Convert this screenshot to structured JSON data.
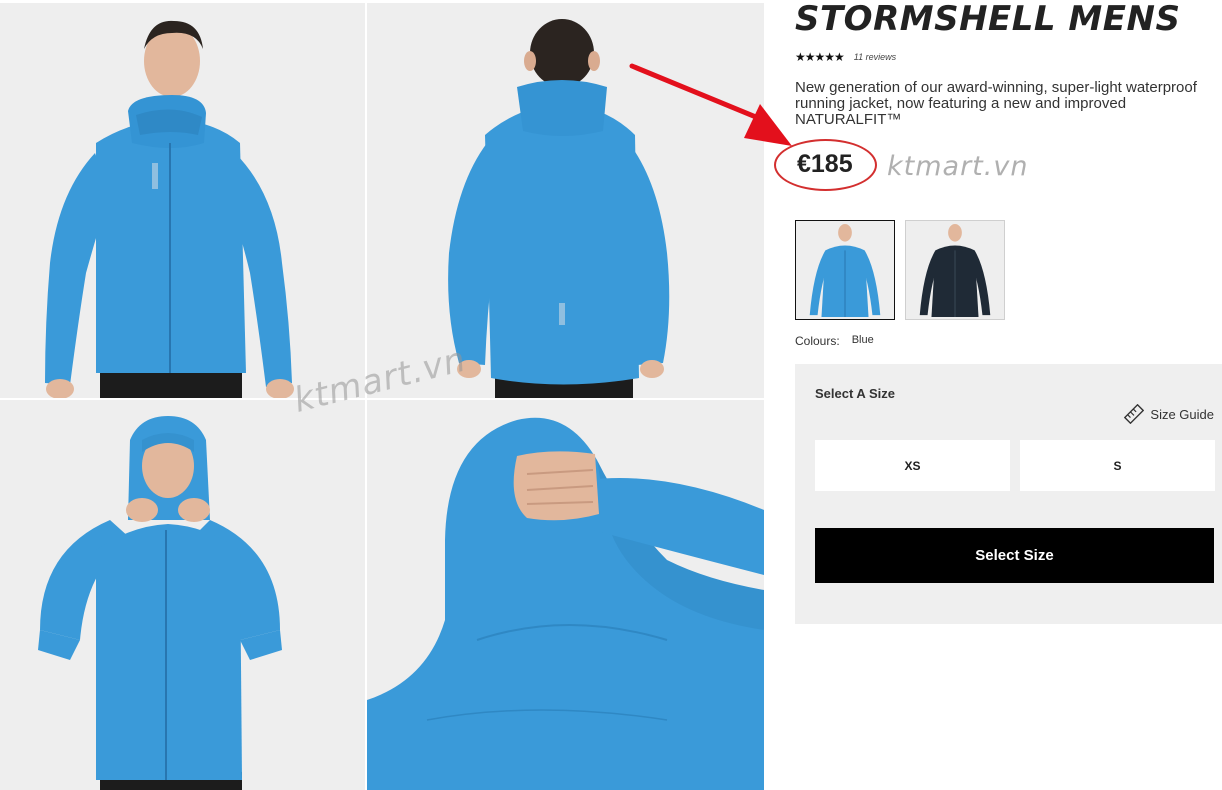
{
  "product": {
    "title": "STORMSHELL MENS",
    "stars": "★★★★★",
    "reviews": "11 reviews",
    "description": "New generation of our award-winning, super-light waterproof running jacket, now featuring a new and improved NATURALFIT™",
    "price": "€185"
  },
  "watermark": "ktmart.vn",
  "colour": {
    "label": "Colours:",
    "value": "Blue"
  },
  "swatches": [
    {
      "name": "Blue",
      "hex": "#3a9ad9"
    },
    {
      "name": "Black",
      "hex": "#1f2a36"
    }
  ],
  "size": {
    "title": "Select A Size",
    "guide_label": "Size Guide",
    "options": [
      "XS",
      "S"
    ],
    "cta": "Select Size"
  },
  "colors": {
    "jacket_blue": "#3a9ad9",
    "annotation_red": "#e3101c"
  }
}
